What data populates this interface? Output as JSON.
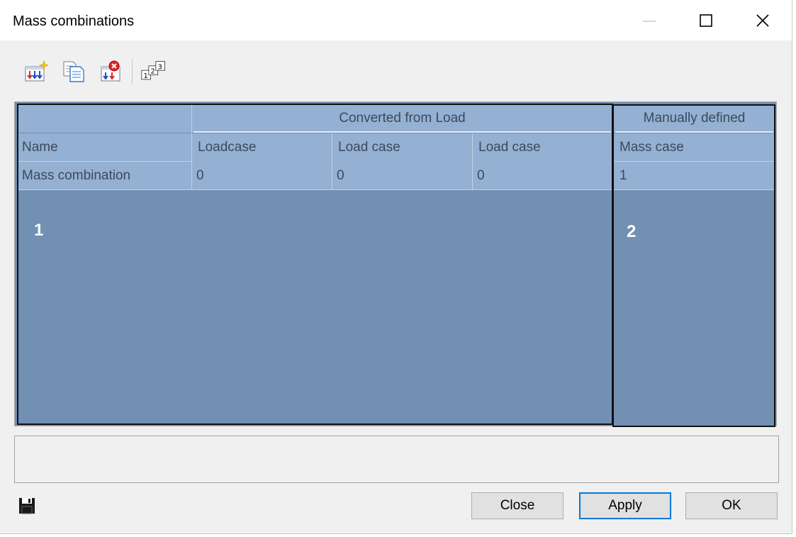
{
  "window": {
    "title": "Mass combinations",
    "controls": [
      "minimize-icon",
      "maximize-icon",
      "close-icon"
    ]
  },
  "toolbar": {
    "tools": [
      {
        "name": "new-combination-icon"
      },
      {
        "name": "copy-icon"
      },
      {
        "name": "delete-icon"
      },
      {
        "name": "numbering-icon"
      }
    ]
  },
  "grid": {
    "group_headers": {
      "converted": "Converted from Load",
      "manual": "Manually defined"
    },
    "columns": [
      "Name",
      "Loadcase",
      "Load case",
      "Load case",
      "Mass case"
    ],
    "rows": [
      [
        "Mass combination",
        "0",
        "0",
        "0",
        "1"
      ]
    ],
    "region_labels": [
      "1",
      "2"
    ]
  },
  "footer": {
    "save_icon": "save-icon",
    "buttons": {
      "close": "Close",
      "apply": "Apply",
      "ok": "OK"
    }
  },
  "colors": {
    "header_fill": "#94b0d3",
    "grid_background": "#7190b3",
    "accent": "#0078d7"
  }
}
